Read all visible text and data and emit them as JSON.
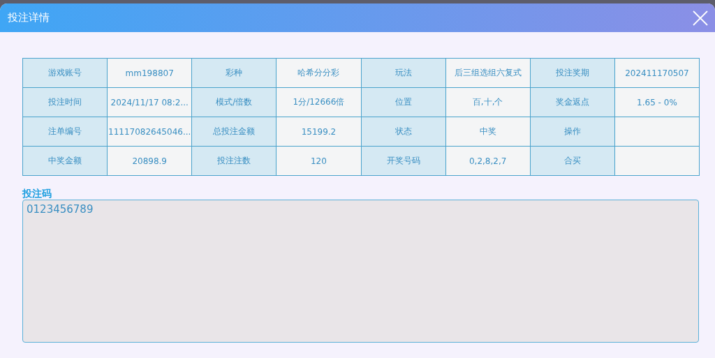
{
  "window": {
    "title": "投注详情"
  },
  "details": {
    "rows": [
      [
        {
          "label": "游戏账号",
          "value": "mm198807"
        },
        {
          "label": "彩种",
          "value": "哈希分分彩"
        },
        {
          "label": "玩法",
          "value": "后三组选组六复式"
        },
        {
          "label": "投注奖期",
          "value": "202411170507"
        }
      ],
      [
        {
          "label": "投注时间",
          "value": "2024/11/17 08:2..."
        },
        {
          "label": "模式/倍数",
          "value": "1分/12666倍"
        },
        {
          "label": "位置",
          "value": "百,十,个"
        },
        {
          "label": "奖金返点",
          "value": "1.65 - 0%"
        }
      ],
      [
        {
          "label": "注单编号",
          "value": "11117082645046..."
        },
        {
          "label": "总投注金额",
          "value": "15199.2"
        },
        {
          "label": "状态",
          "value": "中奖"
        },
        {
          "label": "操作"
        }
      ],
      [
        {
          "label": "中奖金额",
          "value": "20898.9"
        },
        {
          "label": "投注注数",
          "value": "120"
        },
        {
          "label": "开奖号码",
          "value": "0,2,8,2,7"
        },
        {
          "label": "合买"
        }
      ]
    ]
  },
  "bet_code": {
    "label": "投注码",
    "value": "0123456789"
  }
}
